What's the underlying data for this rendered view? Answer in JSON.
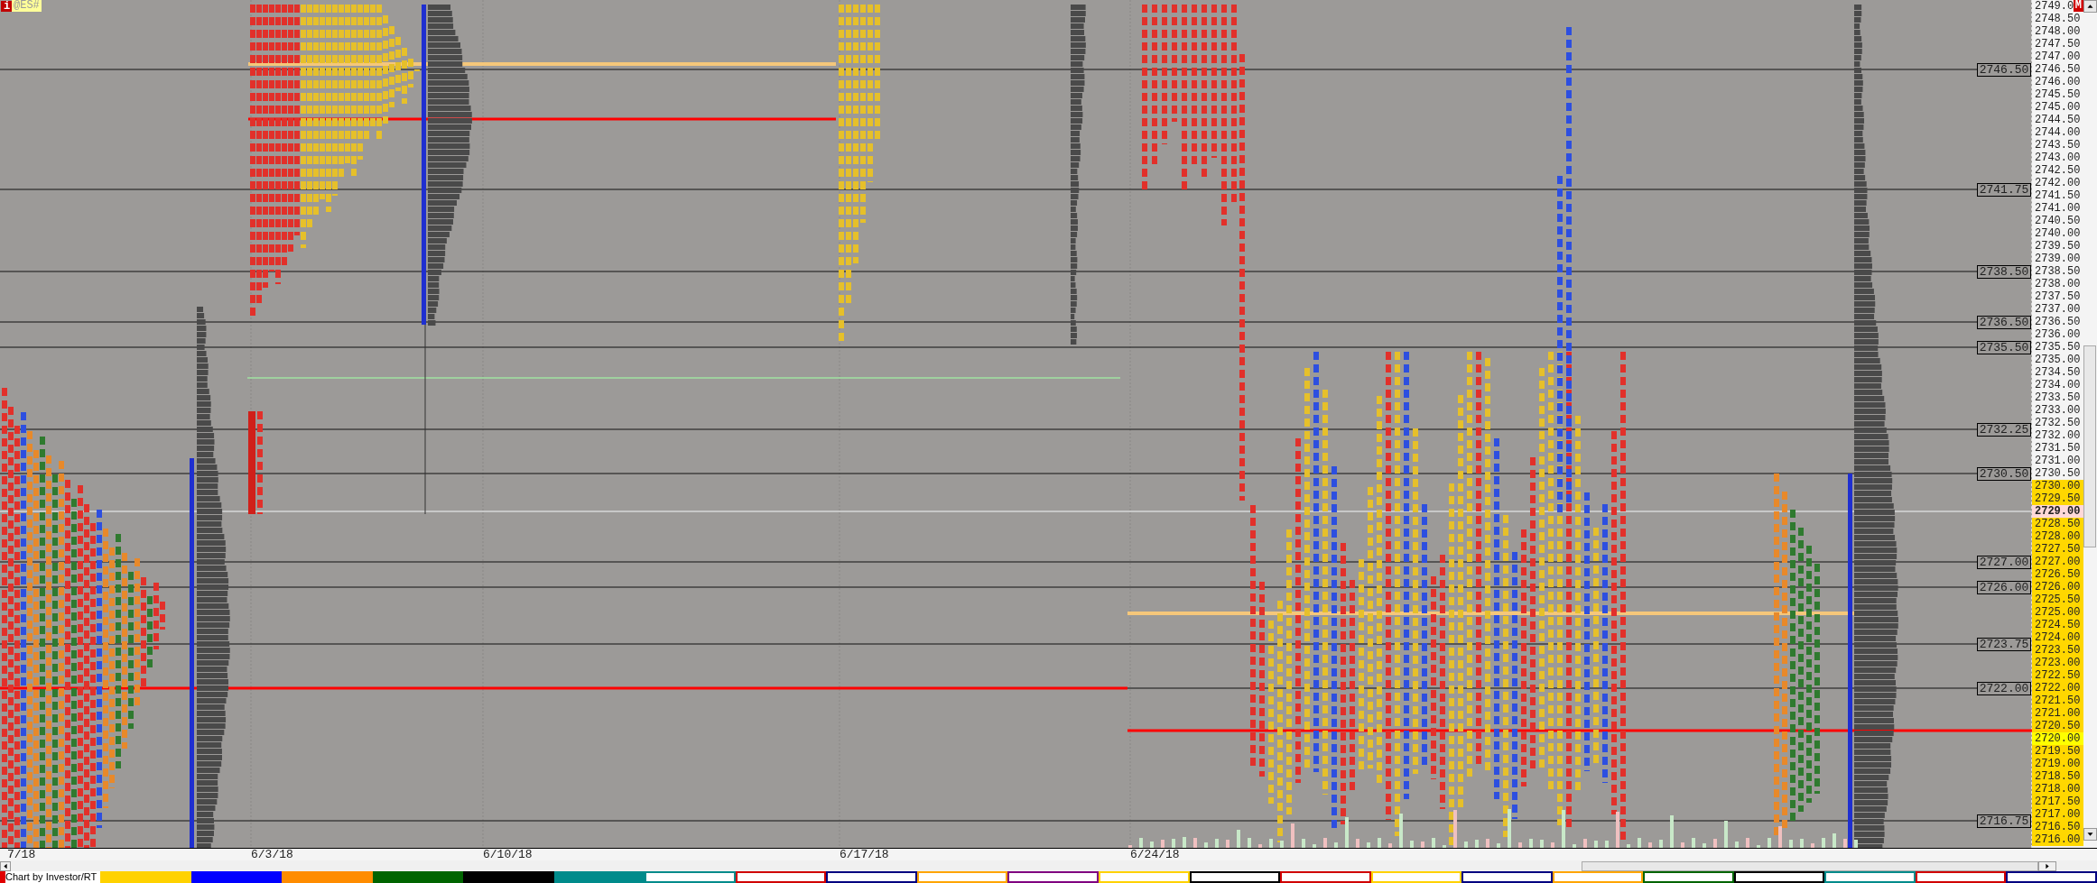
{
  "chart": {
    "symbol_badge": "@ES#",
    "info_badge": "i",
    "mode_badge": "M",
    "level_lines": [
      {
        "label": "2746.50"
      },
      {
        "label": "2741.75"
      },
      {
        "label": "2738.50"
      },
      {
        "label": "2736.50"
      },
      {
        "label": "2735.50"
      },
      {
        "label": "2732.25"
      },
      {
        "label": "2730.50"
      },
      {
        "label": "2727.00"
      },
      {
        "label": "2726.00"
      },
      {
        "label": "2723.75"
      },
      {
        "label": "2722.00"
      },
      {
        "label": "2716.75"
      }
    ]
  },
  "price_scale": [
    {
      "label": "2749.0",
      "kind": "plain"
    },
    {
      "label": "2748.50",
      "kind": "plain"
    },
    {
      "label": "2748.00",
      "kind": "plain"
    },
    {
      "label": "2747.50",
      "kind": "plain"
    },
    {
      "label": "2747.00",
      "kind": "plain"
    },
    {
      "label": "2746.50",
      "kind": "plain"
    },
    {
      "label": "2746.00",
      "kind": "plain"
    },
    {
      "label": "2745.50",
      "kind": "plain"
    },
    {
      "label": "2745.00",
      "kind": "plain"
    },
    {
      "label": "2744.50",
      "kind": "plain"
    },
    {
      "label": "2744.00",
      "kind": "plain"
    },
    {
      "label": "2743.50",
      "kind": "plain"
    },
    {
      "label": "2743.00",
      "kind": "plain"
    },
    {
      "label": "2742.50",
      "kind": "plain"
    },
    {
      "label": "2742.00",
      "kind": "plain"
    },
    {
      "label": "2741.50",
      "kind": "plain"
    },
    {
      "label": "2741.00",
      "kind": "plain"
    },
    {
      "label": "2740.50",
      "kind": "plain"
    },
    {
      "label": "2740.00",
      "kind": "plain"
    },
    {
      "label": "2739.50",
      "kind": "plain"
    },
    {
      "label": "2739.00",
      "kind": "plain"
    },
    {
      "label": "2738.50",
      "kind": "plain"
    },
    {
      "label": "2738.00",
      "kind": "plain"
    },
    {
      "label": "2737.50",
      "kind": "plain"
    },
    {
      "label": "2737.00",
      "kind": "plain"
    },
    {
      "label": "2736.50",
      "kind": "plain"
    },
    {
      "label": "2736.00",
      "kind": "plain"
    },
    {
      "label": "2735.50",
      "kind": "plain"
    },
    {
      "label": "2735.00",
      "kind": "plain"
    },
    {
      "label": "2734.50",
      "kind": "plain"
    },
    {
      "label": "2734.00",
      "kind": "plain"
    },
    {
      "label": "2733.50",
      "kind": "plain"
    },
    {
      "label": "2733.00",
      "kind": "plain"
    },
    {
      "label": "2732.50",
      "kind": "plain"
    },
    {
      "label": "2732.00",
      "kind": "plain"
    },
    {
      "label": "2731.50",
      "kind": "plain"
    },
    {
      "label": "2731.00",
      "kind": "plain"
    },
    {
      "label": "2730.50",
      "kind": "plain"
    },
    {
      "label": "2730.00",
      "kind": "range"
    },
    {
      "label": "2729.50",
      "kind": "range"
    },
    {
      "label": "2729.00",
      "kind": "last"
    },
    {
      "label": "2728.50",
      "kind": "range"
    },
    {
      "label": "2728.00",
      "kind": "range"
    },
    {
      "label": "2727.50",
      "kind": "range"
    },
    {
      "label": "2727.00",
      "kind": "range"
    },
    {
      "label": "2726.50",
      "kind": "range"
    },
    {
      "label": "2726.00",
      "kind": "range"
    },
    {
      "label": "2725.50",
      "kind": "range"
    },
    {
      "label": "2725.00",
      "kind": "range"
    },
    {
      "label": "2724.50",
      "kind": "range"
    },
    {
      "label": "2724.00",
      "kind": "range"
    },
    {
      "label": "2723.50",
      "kind": "range"
    },
    {
      "label": "2723.00",
      "kind": "range"
    },
    {
      "label": "2722.50",
      "kind": "range"
    },
    {
      "label": "2722.00",
      "kind": "range"
    },
    {
      "label": "2721.50",
      "kind": "range"
    },
    {
      "label": "2721.00",
      "kind": "range"
    },
    {
      "label": "2720.50",
      "kind": "range"
    },
    {
      "label": "2720.00",
      "kind": "poc"
    },
    {
      "label": "2719.50",
      "kind": "range"
    },
    {
      "label": "2719.00",
      "kind": "range"
    },
    {
      "label": "2718.50",
      "kind": "range"
    },
    {
      "label": "2718.00",
      "kind": "range"
    },
    {
      "label": "2717.50",
      "kind": "range"
    },
    {
      "label": "2717.00",
      "kind": "range"
    },
    {
      "label": "2716.50",
      "kind": "range"
    },
    {
      "label": "2716.00",
      "kind": "range"
    }
  ],
  "date_axis": [
    {
      "label": "7/18"
    },
    {
      "label": "6/3/18"
    },
    {
      "label": "6/10/18"
    },
    {
      "label": "6/17/18"
    },
    {
      "label": "6/24/18"
    }
  ],
  "footer": {
    "credit": "Chart by Investor/RT",
    "swatches": [
      {
        "kind": "filled",
        "color": "#ffd200"
      },
      {
        "kind": "filled",
        "color": "#0000ff"
      },
      {
        "kind": "filled",
        "color": "#ff8c00"
      },
      {
        "kind": "filled",
        "color": "#006400"
      },
      {
        "kind": "filled",
        "color": "#000000"
      },
      {
        "kind": "filled",
        "color": "#008b8b"
      },
      {
        "kind": "outline",
        "color": "#008b8b"
      },
      {
        "kind": "outline",
        "color": "#d00000"
      },
      {
        "kind": "outline",
        "color": "#000080"
      },
      {
        "kind": "outline",
        "color": "#ffa500"
      },
      {
        "kind": "outline",
        "color": "#800080"
      },
      {
        "kind": "outline",
        "color": "#ffd200"
      },
      {
        "kind": "outline",
        "color": "#000000"
      },
      {
        "kind": "outline",
        "color": "#d00000"
      },
      {
        "kind": "outline",
        "color": "#ffd200"
      },
      {
        "kind": "outline",
        "color": "#000080"
      },
      {
        "kind": "outline",
        "color": "#ffa500"
      },
      {
        "kind": "outline",
        "color": "#006400"
      },
      {
        "kind": "outline",
        "color": "#000000"
      },
      {
        "kind": "outline",
        "color": "#008b8b"
      },
      {
        "kind": "outline",
        "color": "#d00000"
      },
      {
        "kind": "outline",
        "color": "#000080"
      }
    ]
  }
}
